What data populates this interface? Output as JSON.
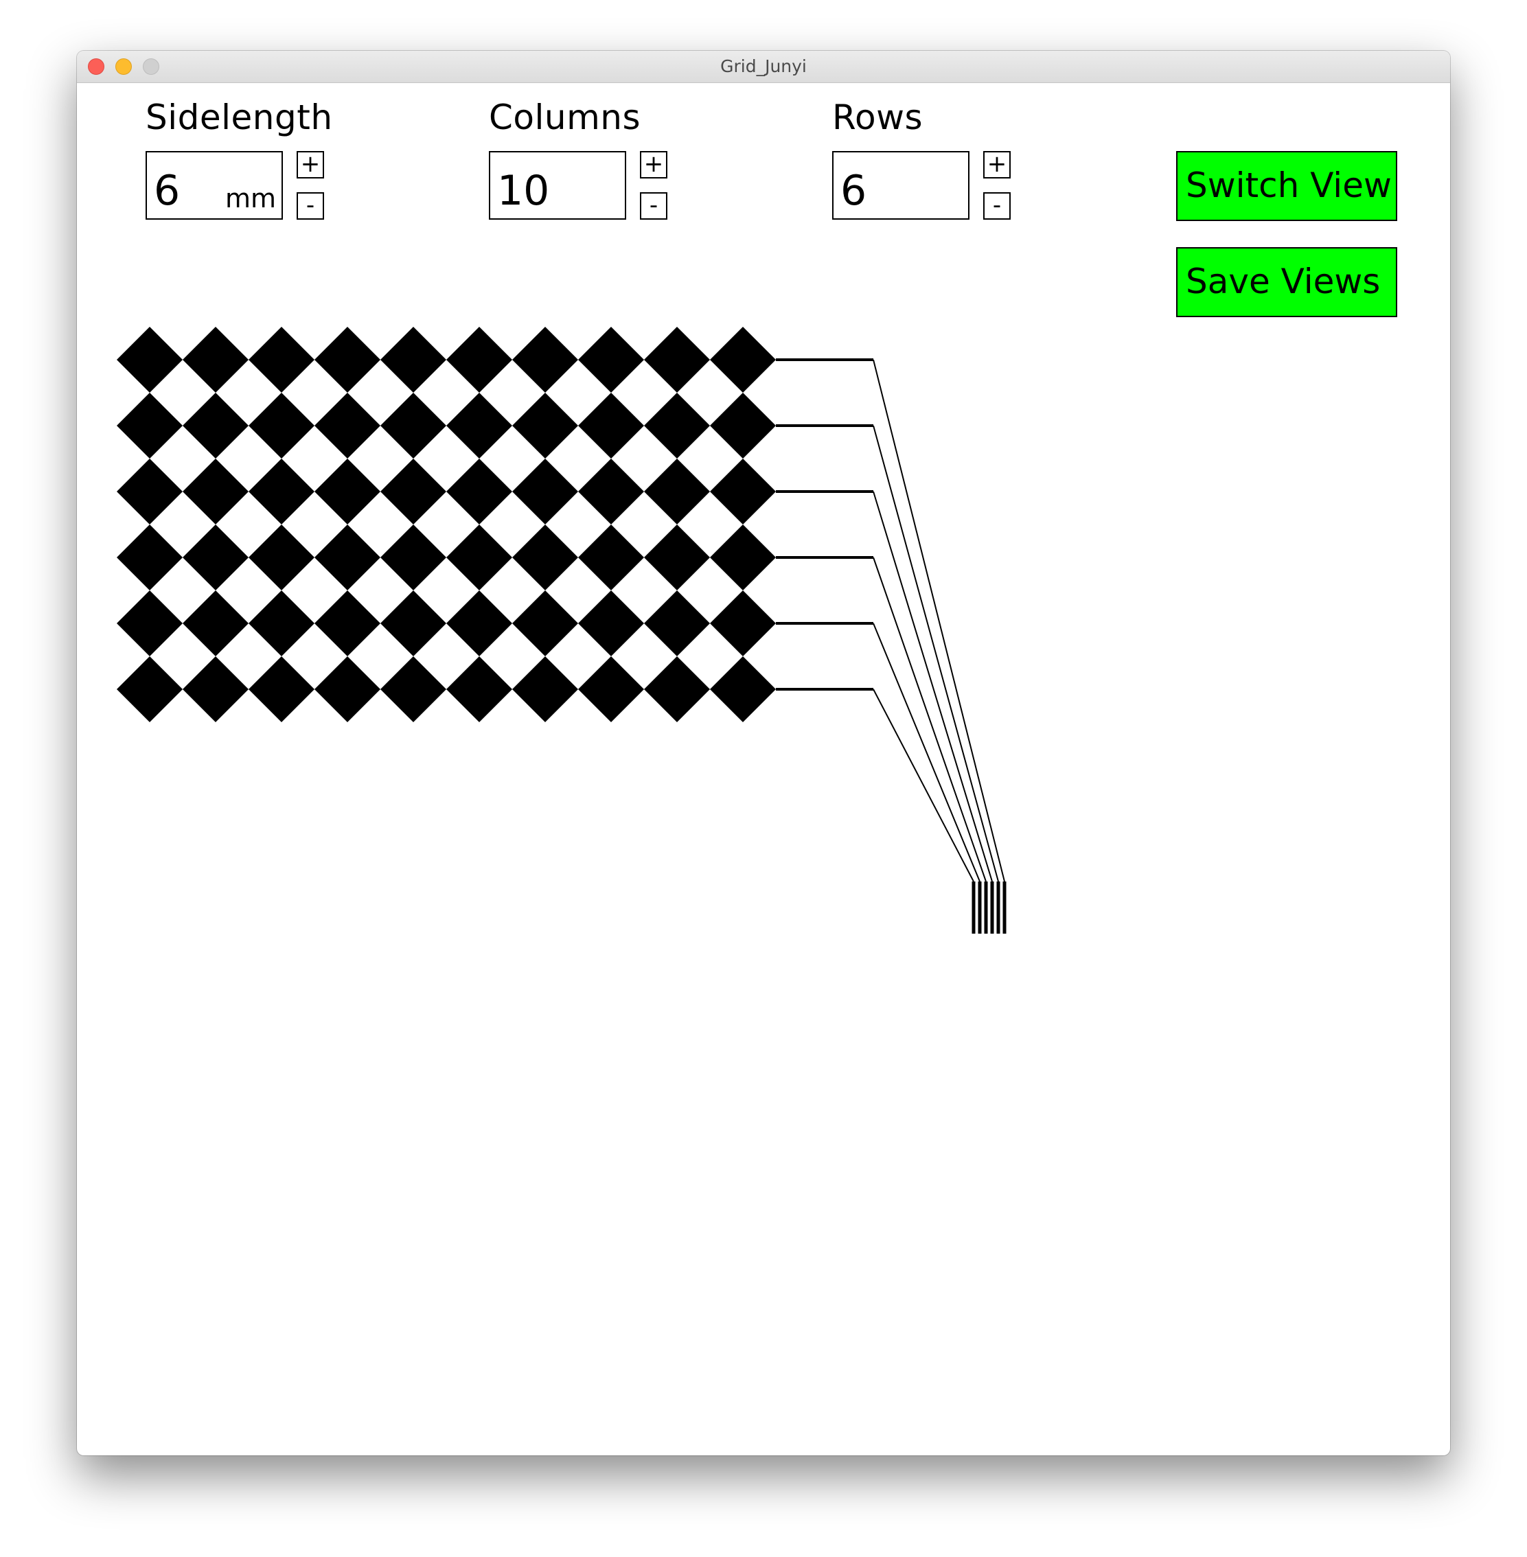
{
  "window": {
    "title": "Grid_Junyi"
  },
  "controls": {
    "sidelength": {
      "label": "Sidelength",
      "value": "6",
      "unit": "mm"
    },
    "columns": {
      "label": "Columns",
      "value": "10"
    },
    "rows": {
      "label": "Rows",
      "value": "6"
    },
    "increment_label": "+",
    "decrement_label": "-"
  },
  "actions": {
    "switch_view_label": "Switch View",
    "save_views_label": "Save Views"
  },
  "grid": {
    "columns": 10,
    "rows": 6
  },
  "colors": {
    "button_bg": "#00ff00",
    "tile": "#000000"
  }
}
